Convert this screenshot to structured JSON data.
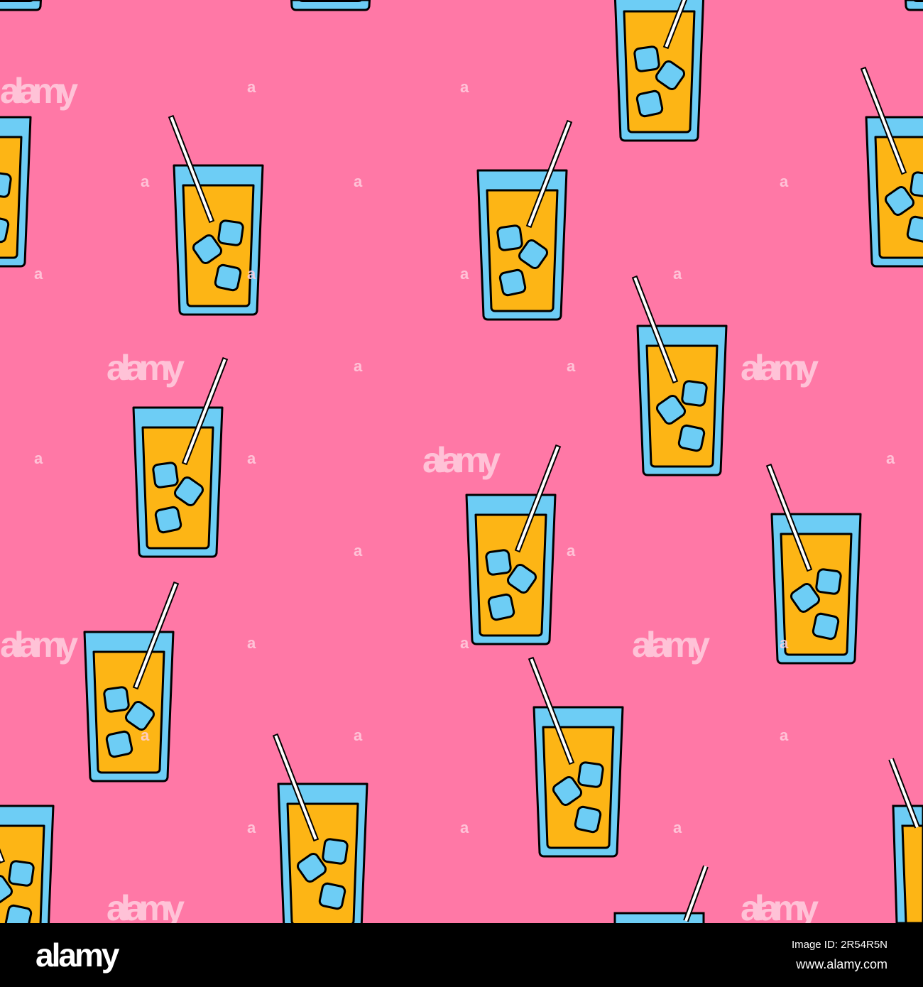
{
  "colors": {
    "background": "#ff78a6",
    "glass": "#6dcdf5",
    "juice": "#fdb515",
    "outline": "#000000",
    "straw": "#ffffff"
  },
  "watermark": {
    "word": "alamy",
    "letter": "a"
  },
  "footer": {
    "logo": "alamy",
    "image_id": "Image ID: 2R54R5N",
    "website": "www.alamy.com"
  }
}
